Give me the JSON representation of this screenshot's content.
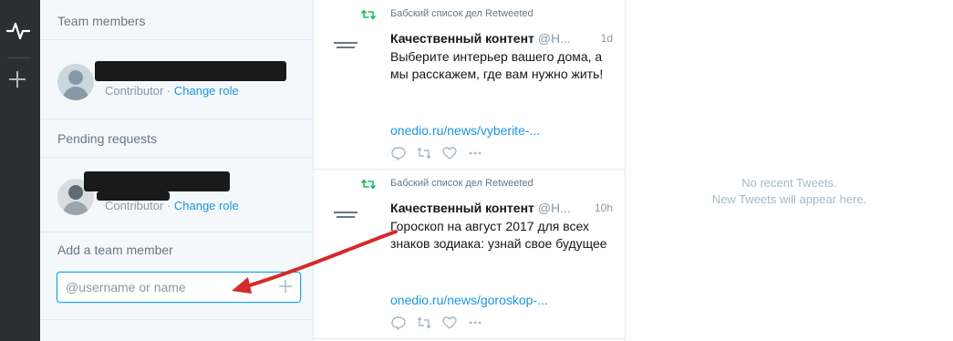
{
  "rail": {
    "icons": [
      "activity-icon",
      "add-column-icon"
    ]
  },
  "team_panel": {
    "members_heading": "Team members",
    "members": [
      {
        "role": "Contributor",
        "separator": " · ",
        "action": "Change role",
        "avatar": "default-avatar-icon"
      }
    ],
    "pending_heading": "Pending requests",
    "pending": [
      {
        "role": "Contributor",
        "separator": " · ",
        "action": "Change role",
        "avatar": "photo-avatar"
      }
    ],
    "add_heading": "Add a team member",
    "add_placeholder": "@username or name"
  },
  "tweets": [
    {
      "retweet_label": "Бабский список дел Retweeted",
      "author": "Качественный контент",
      "handle": "@H...",
      "time": "1d",
      "text": "Выберите интерьер вашего дома, а мы расскажем, где вам нужно жить!",
      "link": "onedio.ru/news/vyberite-..."
    },
    {
      "retweet_label": "Бабский список дел Retweeted",
      "author": "Качественный контент",
      "handle": "@H...",
      "time": "10h",
      "text": "Гороскоп на август 2017 для всех знаков зодиака: узнай свое будущее",
      "link": "onedio.ru/news/goroskop-..."
    }
  ],
  "empty_column": {
    "line1": "No recent Tweets.",
    "line2": "New Tweets will appear here."
  },
  "colors": {
    "accent": "#1da1f2",
    "link": "#1b95e0",
    "rail": "#292f33",
    "retweet": "#17bf63",
    "annotation_arrow": "#d42a2a"
  }
}
